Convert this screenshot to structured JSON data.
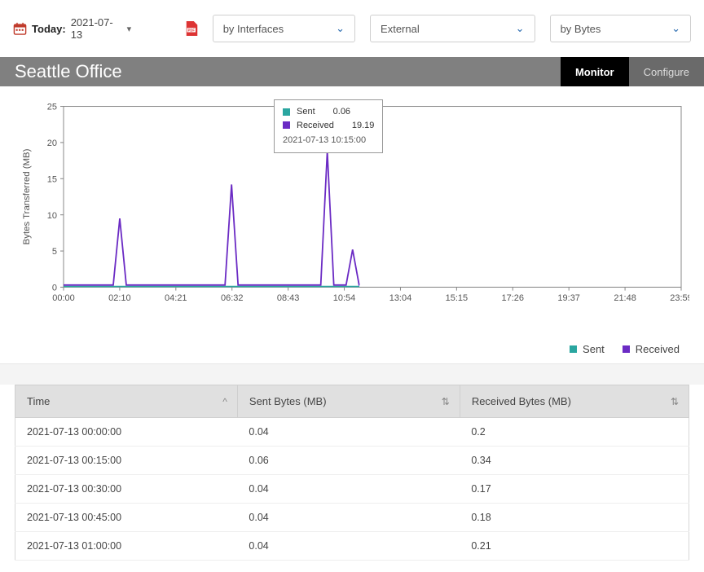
{
  "top": {
    "today_label": "Today:",
    "today_value": "2021-07-13",
    "dd_interfaces": "by Interfaces",
    "dd_external": "External",
    "dd_bytes": "by Bytes"
  },
  "title": "Seattle Office",
  "tabs": {
    "monitor": "Monitor",
    "configure": "Configure"
  },
  "chart_data": {
    "type": "line",
    "ylabel": "Bytes Transferred (MB)",
    "ylim": [
      0,
      25
    ],
    "yticks": [
      0,
      5,
      10,
      15,
      20,
      25
    ],
    "xticks": [
      "00:00",
      "02:10",
      "04:21",
      "06:32",
      "08:43",
      "10:54",
      "13:04",
      "15:15",
      "17:26",
      "19:37",
      "21:48",
      "23:59"
    ],
    "series": [
      {
        "name": "Sent",
        "color": "#2aa6a0"
      },
      {
        "name": "Received",
        "color": "#6b2bc4"
      }
    ],
    "tooltip": {
      "sent_label": "Sent",
      "sent_value": "0.06",
      "recv_label": "Received",
      "recv_value": "19.19",
      "timestamp": "2021-07-13 10:15:00"
    },
    "peaks_received": [
      {
        "x_frac": 0.091,
        "value": 9.5
      },
      {
        "x_frac": 0.272,
        "value": 14.2
      },
      {
        "x_frac": 0.427,
        "value": 18.8
      },
      {
        "x_frac": 0.468,
        "value": 5.2
      }
    ],
    "last_x_frac": 0.479
  },
  "legend": {
    "sent": "Sent",
    "received": "Received"
  },
  "table": {
    "headers": {
      "time": "Time",
      "sent": "Sent Bytes (MB)",
      "recv": "Received Bytes (MB)"
    },
    "rows": [
      {
        "time": "2021-07-13 00:00:00",
        "sent": "0.04",
        "recv": "0.2"
      },
      {
        "time": "2021-07-13 00:15:00",
        "sent": "0.06",
        "recv": "0.34"
      },
      {
        "time": "2021-07-13 00:30:00",
        "sent": "0.04",
        "recv": "0.17"
      },
      {
        "time": "2021-07-13 00:45:00",
        "sent": "0.04",
        "recv": "0.18"
      },
      {
        "time": "2021-07-13 01:00:00",
        "sent": "0.04",
        "recv": "0.21"
      }
    ]
  }
}
